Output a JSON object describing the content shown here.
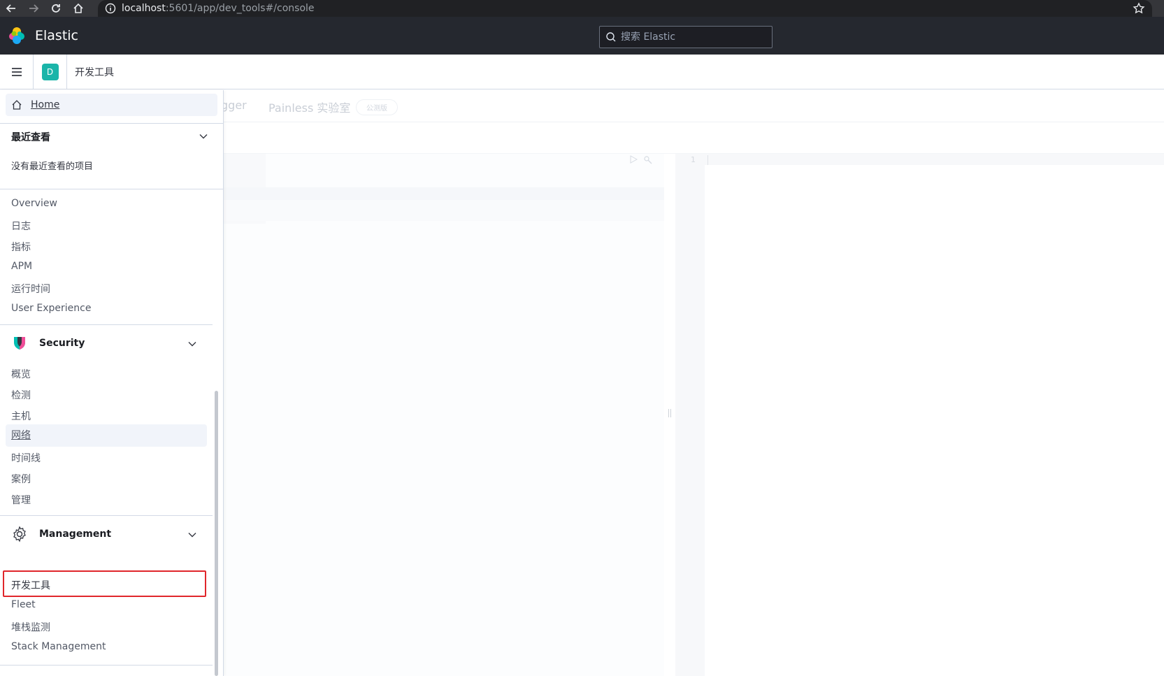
{
  "browser": {
    "url_host": "localhost",
    "url_rest": ":5601/app/dev_tools#/console"
  },
  "header": {
    "brand": "Elastic",
    "search_placeholder": "搜索 Elastic"
  },
  "breadcrumb": {
    "space_initial": "D",
    "title": "开发工具"
  },
  "devtools": {
    "tab_partial": "gger",
    "tab_painless": "Painless 实验室",
    "beta_badge": "公测版",
    "output_line_number": "1"
  },
  "sidenav": {
    "home_label": "Home",
    "recent": {
      "title": "最近查看",
      "empty_text": "没有最近查看的项目"
    },
    "observability_items": [
      "Overview",
      "日志",
      "指标",
      "APM",
      "运行时间",
      "User Experience"
    ],
    "security": {
      "title": "Security",
      "items": [
        "概览",
        "检测",
        "主机",
        "网络",
        "时间线",
        "案例",
        "管理"
      ]
    },
    "management": {
      "title": "Management",
      "items": [
        "开发工具",
        "Fleet",
        "堆栈监测",
        "Stack Management"
      ]
    }
  },
  "colors": {
    "header_bg": "#25282f",
    "space_avatar": "#1ab5a9",
    "highlight_outline": "#e0262b",
    "hover_bg": "#f1f4fa"
  }
}
